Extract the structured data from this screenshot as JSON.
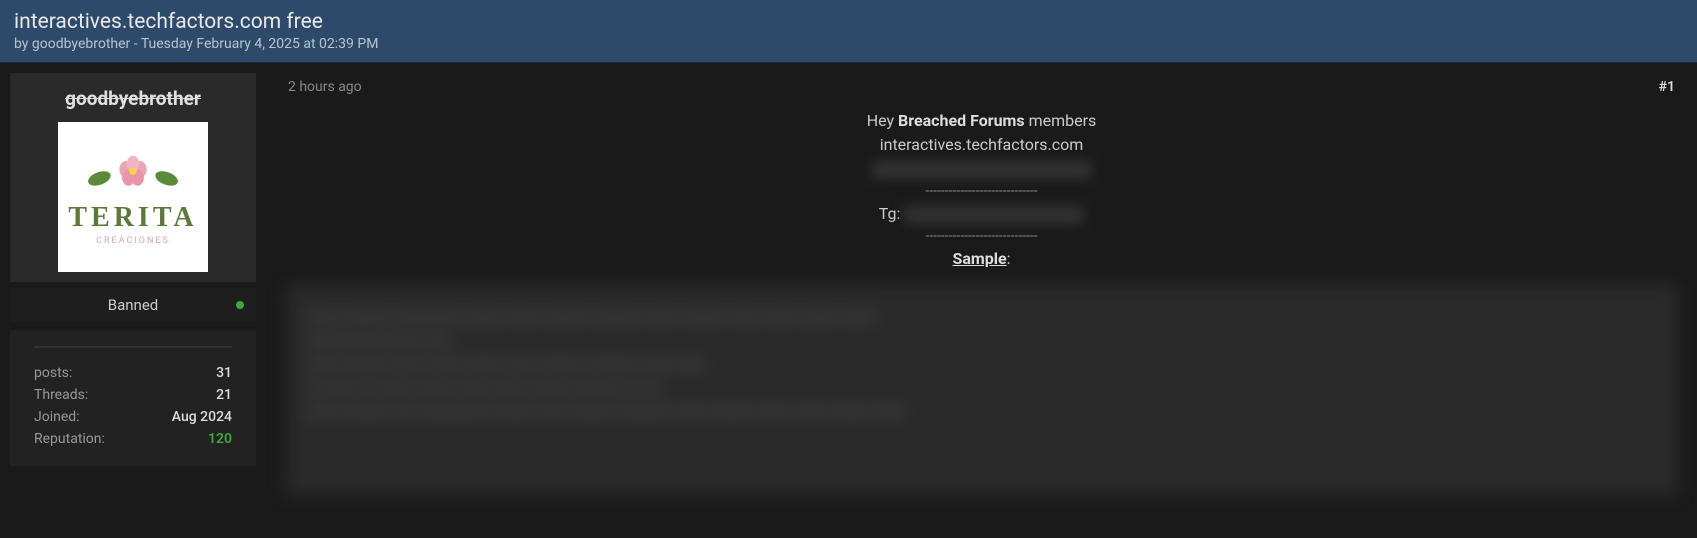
{
  "header": {
    "title": "interactives.techfactors.com free",
    "by_prefix": "by ",
    "author": "goodbyebrother",
    "separator": " - ",
    "date": "Tuesday February 4, 2025 at 02:39 PM"
  },
  "user": {
    "name": "goodbyebrother",
    "avatar_text": "TERITA",
    "avatar_sub": "CREACIONES",
    "status": "Banned",
    "stats": {
      "posts_label": "posts:",
      "posts_value": "31",
      "threads_label": "Threads:",
      "threads_value": "21",
      "joined_label": "Joined:",
      "joined_value": "Aug 2024",
      "rep_label": "Reputation:",
      "rep_value": "120"
    }
  },
  "post": {
    "timestamp": "2 hours ago",
    "number": "#1",
    "line1_pre": "Hey ",
    "line1_bold": "Breached Forums",
    "line1_post": " members",
    "line2": "interactives.techfactors.com",
    "divider": "-----------------------------",
    "tg_label": "Tg:  ",
    "sample_label": "Sample",
    "sample_colon": ":"
  }
}
